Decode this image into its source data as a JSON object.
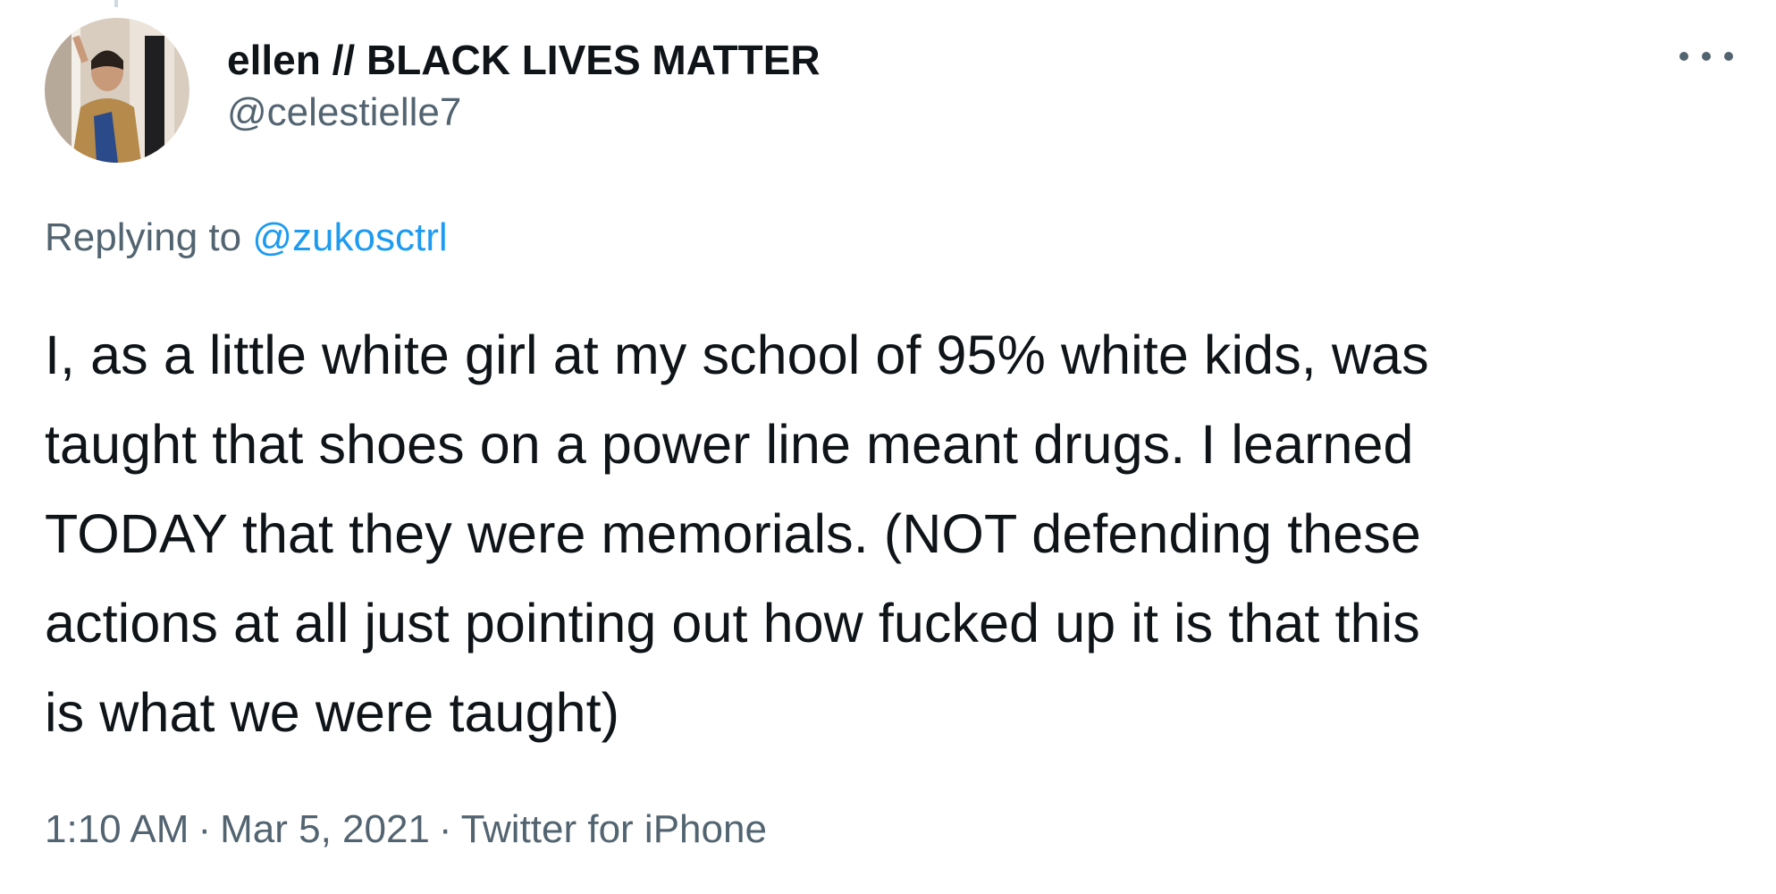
{
  "tweet": {
    "author": {
      "display_name": "ellen // BLACK LIVES MATTER",
      "handle": "@celestielle7"
    },
    "reply_prefix": "Replying to",
    "reply_to": "@zukosctrl",
    "text_lines": [
      "I, as a little white girl at my school of 95% white kids, was",
      "taught that shoes on a power line meant drugs. I learned",
      "TODAY that they were memorials. (NOT defending these",
      "actions at all just pointing out how fucked up it is that this",
      "is what we were taught)"
    ],
    "time": "1:10 AM",
    "date": "Mar 5, 2021",
    "source": "Twitter for iPhone",
    "separator": "·"
  },
  "icons": {
    "more": "more-horizontal-icon"
  },
  "colors": {
    "primary_text": "#0f1419",
    "secondary_text": "#536471",
    "link": "#1d9bf0",
    "background": "#ffffff"
  }
}
